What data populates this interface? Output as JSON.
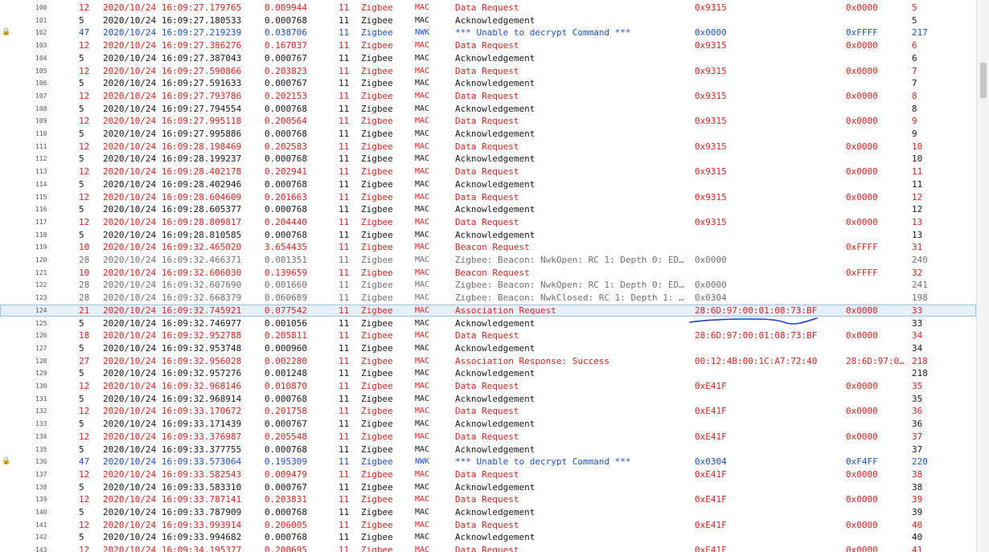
{
  "rows": [
    {
      "idx": "100",
      "lock": "",
      "len": "12",
      "time": "2020/10/24 16:09:27.179765",
      "delta": "0.009944",
      "ch": "11",
      "proto": "Zigbee",
      "layer": "MAC",
      "info": "Data Request",
      "src": "0x9315",
      "dst": "0x0000",
      "seq": "5",
      "color": "red"
    },
    {
      "idx": "101",
      "lock": "",
      "len": "5",
      "time": "2020/10/24 16:09:27.180533",
      "delta": "0.000768",
      "ch": "11",
      "proto": "Zigbee",
      "layer": "MAC",
      "info": "Acknowledgement",
      "src": "",
      "dst": "",
      "seq": "5",
      "color": "black"
    },
    {
      "idx": "102",
      "lock": "🔒",
      "len": "47",
      "time": "2020/10/24 16:09:27.219239",
      "delta": "0.038706",
      "ch": "11",
      "proto": "Zigbee",
      "layer": "NWK",
      "info": "*** Unable to decrypt Command ***",
      "src": "0x0000",
      "dst": "0xFFFF",
      "seq": "217",
      "color": "blue"
    },
    {
      "idx": "103",
      "lock": "",
      "len": "12",
      "time": "2020/10/24 16:09:27.386276",
      "delta": "0.167037",
      "ch": "11",
      "proto": "Zigbee",
      "layer": "MAC",
      "info": "Data Request",
      "src": "0x9315",
      "dst": "0x0000",
      "seq": "6",
      "color": "red"
    },
    {
      "idx": "104",
      "lock": "",
      "len": "5",
      "time": "2020/10/24 16:09:27.387043",
      "delta": "0.000767",
      "ch": "11",
      "proto": "Zigbee",
      "layer": "MAC",
      "info": "Acknowledgement",
      "src": "",
      "dst": "",
      "seq": "6",
      "color": "black"
    },
    {
      "idx": "105",
      "lock": "",
      "len": "12",
      "time": "2020/10/24 16:09:27.590866",
      "delta": "0.203823",
      "ch": "11",
      "proto": "Zigbee",
      "layer": "MAC",
      "info": "Data Request",
      "src": "0x9315",
      "dst": "0x0000",
      "seq": "7",
      "color": "red"
    },
    {
      "idx": "106",
      "lock": "",
      "len": "5",
      "time": "2020/10/24 16:09:27.591633",
      "delta": "0.000767",
      "ch": "11",
      "proto": "Zigbee",
      "layer": "MAC",
      "info": "Acknowledgement",
      "src": "",
      "dst": "",
      "seq": "7",
      "color": "black"
    },
    {
      "idx": "107",
      "lock": "",
      "len": "12",
      "time": "2020/10/24 16:09:27.793786",
      "delta": "0.202153",
      "ch": "11",
      "proto": "Zigbee",
      "layer": "MAC",
      "info": "Data Request",
      "src": "0x9315",
      "dst": "0x0000",
      "seq": "8",
      "color": "red"
    },
    {
      "idx": "108",
      "lock": "",
      "len": "5",
      "time": "2020/10/24 16:09:27.794554",
      "delta": "0.000768",
      "ch": "11",
      "proto": "Zigbee",
      "layer": "MAC",
      "info": "Acknowledgement",
      "src": "",
      "dst": "",
      "seq": "8",
      "color": "black"
    },
    {
      "idx": "109",
      "lock": "",
      "len": "12",
      "time": "2020/10/24 16:09:27.995118",
      "delta": "0.200564",
      "ch": "11",
      "proto": "Zigbee",
      "layer": "MAC",
      "info": "Data Request",
      "src": "0x9315",
      "dst": "0x0000",
      "seq": "9",
      "color": "red"
    },
    {
      "idx": "110",
      "lock": "",
      "len": "5",
      "time": "2020/10/24 16:09:27.995886",
      "delta": "0.000768",
      "ch": "11",
      "proto": "Zigbee",
      "layer": "MAC",
      "info": "Acknowledgement",
      "src": "",
      "dst": "",
      "seq": "9",
      "color": "black"
    },
    {
      "idx": "111",
      "lock": "",
      "len": "12",
      "time": "2020/10/24 16:09:28.198469",
      "delta": "0.202583",
      "ch": "11",
      "proto": "Zigbee",
      "layer": "MAC",
      "info": "Data Request",
      "src": "0x9315",
      "dst": "0x0000",
      "seq": "10",
      "color": "red"
    },
    {
      "idx": "112",
      "lock": "",
      "len": "5",
      "time": "2020/10/24 16:09:28.199237",
      "delta": "0.000768",
      "ch": "11",
      "proto": "Zigbee",
      "layer": "MAC",
      "info": "Acknowledgement",
      "src": "",
      "dst": "",
      "seq": "10",
      "color": "black"
    },
    {
      "idx": "113",
      "lock": "",
      "len": "12",
      "time": "2020/10/24 16:09:28.402178",
      "delta": "0.202941",
      "ch": "11",
      "proto": "Zigbee",
      "layer": "MAC",
      "info": "Data Request",
      "src": "0x9315",
      "dst": "0x0000",
      "seq": "11",
      "color": "red"
    },
    {
      "idx": "114",
      "lock": "",
      "len": "5",
      "time": "2020/10/24 16:09:28.402946",
      "delta": "0.000768",
      "ch": "11",
      "proto": "Zigbee",
      "layer": "MAC",
      "info": "Acknowledgement",
      "src": "",
      "dst": "",
      "seq": "11",
      "color": "black"
    },
    {
      "idx": "115",
      "lock": "",
      "len": "12",
      "time": "2020/10/24 16:09:28.604609",
      "delta": "0.201663",
      "ch": "11",
      "proto": "Zigbee",
      "layer": "MAC",
      "info": "Data Request",
      "src": "0x9315",
      "dst": "0x0000",
      "seq": "12",
      "color": "red"
    },
    {
      "idx": "116",
      "lock": "",
      "len": "5",
      "time": "2020/10/24 16:09:28.605377",
      "delta": "0.000768",
      "ch": "11",
      "proto": "Zigbee",
      "layer": "MAC",
      "info": "Acknowledgement",
      "src": "",
      "dst": "",
      "seq": "12",
      "color": "black"
    },
    {
      "idx": "117",
      "lock": "",
      "len": "12",
      "time": "2020/10/24 16:09:28.809817",
      "delta": "0.204440",
      "ch": "11",
      "proto": "Zigbee",
      "layer": "MAC",
      "info": "Data Request",
      "src": "0x9315",
      "dst": "0x0000",
      "seq": "13",
      "color": "red"
    },
    {
      "idx": "118",
      "lock": "",
      "len": "5",
      "time": "2020/10/24 16:09:28.810585",
      "delta": "0.000768",
      "ch": "11",
      "proto": "Zigbee",
      "layer": "MAC",
      "info": "Acknowledgement",
      "src": "",
      "dst": "",
      "seq": "13",
      "color": "black"
    },
    {
      "idx": "119",
      "lock": "",
      "len": "10",
      "time": "2020/10/24 16:09:32.465020",
      "delta": "3.654435",
      "ch": "11",
      "proto": "Zigbee",
      "layer": "MAC",
      "info": "Beacon Request",
      "src": "",
      "dst": "0xFFFF",
      "seq": "31",
      "color": "red"
    },
    {
      "idx": "120",
      "lock": "",
      "len": "28",
      "time": "2020/10/24 16:09:32.466371",
      "delta": "0.001351",
      "ch": "11",
      "proto": "Zigbee",
      "layer": "MAC",
      "info": "Zigbee: Beacon: NwkOpen: RC 1: Depth 0: EDC…",
      "src": "0x0000",
      "dst": "",
      "seq": "240",
      "color": "gray"
    },
    {
      "idx": "121",
      "lock": "",
      "len": "10",
      "time": "2020/10/24 16:09:32.606030",
      "delta": "0.139659",
      "ch": "11",
      "proto": "Zigbee",
      "layer": "MAC",
      "info": "Beacon Request",
      "src": "",
      "dst": "0xFFFF",
      "seq": "32",
      "color": "red"
    },
    {
      "idx": "122",
      "lock": "",
      "len": "28",
      "time": "2020/10/24 16:09:32.607690",
      "delta": "0.001660",
      "ch": "11",
      "proto": "Zigbee",
      "layer": "MAC",
      "info": "Zigbee: Beacon: NwkOpen: RC 1: Depth 0: EDC…",
      "src": "0x0000",
      "dst": "",
      "seq": "241",
      "color": "gray"
    },
    {
      "idx": "123",
      "lock": "",
      "len": "28",
      "time": "2020/10/24 16:09:32.668379",
      "delta": "0.060689",
      "ch": "11",
      "proto": "Zigbee",
      "layer": "MAC",
      "info": "Zigbee: Beacon: NwkClosed: RC 1: Depth 1: E…",
      "src": "0x0304",
      "dst": "",
      "seq": "198",
      "color": "gray"
    },
    {
      "idx": "124",
      "lock": "",
      "len": "21",
      "time": "2020/10/24 16:09:32.745921",
      "delta": "0.077542",
      "ch": "11",
      "proto": "Zigbee",
      "layer": "MAC",
      "info": "Association Request",
      "src": "28:6D:97:00:01:08:73:BF",
      "dst": "0x0000",
      "seq": "33",
      "color": "red",
      "selected": true
    },
    {
      "idx": "125",
      "lock": "",
      "len": "5",
      "time": "2020/10/24 16:09:32.746977",
      "delta": "0.001056",
      "ch": "11",
      "proto": "Zigbee",
      "layer": "MAC",
      "info": "Acknowledgement",
      "src": "",
      "dst": "",
      "seq": "33",
      "color": "black"
    },
    {
      "idx": "126",
      "lock": "",
      "len": "18",
      "time": "2020/10/24 16:09:32.952788",
      "delta": "0.205811",
      "ch": "11",
      "proto": "Zigbee",
      "layer": "MAC",
      "info": "Data Request",
      "src": "28:6D:97:00:01:08:73:BF",
      "dst": "0x0000",
      "seq": "34",
      "color": "red"
    },
    {
      "idx": "127",
      "lock": "",
      "len": "5",
      "time": "2020/10/24 16:09:32.953748",
      "delta": "0.000960",
      "ch": "11",
      "proto": "Zigbee",
      "layer": "MAC",
      "info": "Acknowledgement",
      "src": "",
      "dst": "",
      "seq": "34",
      "color": "black"
    },
    {
      "idx": "128",
      "lock": "",
      "len": "27",
      "time": "2020/10/24 16:09:32.956028",
      "delta": "0.002280",
      "ch": "11",
      "proto": "Zigbee",
      "layer": "MAC",
      "info": "Association Response: Success",
      "src": "00:12:4B:00:1C:A7:72:40",
      "dst": "28:6D:97:0…",
      "seq": "218",
      "color": "red"
    },
    {
      "idx": "129",
      "lock": "",
      "len": "5",
      "time": "2020/10/24 16:09:32.957276",
      "delta": "0.001248",
      "ch": "11",
      "proto": "Zigbee",
      "layer": "MAC",
      "info": "Acknowledgement",
      "src": "",
      "dst": "",
      "seq": "218",
      "color": "black"
    },
    {
      "idx": "130",
      "lock": "",
      "len": "12",
      "time": "2020/10/24 16:09:32.968146",
      "delta": "0.010870",
      "ch": "11",
      "proto": "Zigbee",
      "layer": "MAC",
      "info": "Data Request",
      "src": "0xE41F",
      "dst": "0x0000",
      "seq": "35",
      "color": "red"
    },
    {
      "idx": "131",
      "lock": "",
      "len": "5",
      "time": "2020/10/24 16:09:32.968914",
      "delta": "0.000768",
      "ch": "11",
      "proto": "Zigbee",
      "layer": "MAC",
      "info": "Acknowledgement",
      "src": "",
      "dst": "",
      "seq": "35",
      "color": "black"
    },
    {
      "idx": "132",
      "lock": "",
      "len": "12",
      "time": "2020/10/24 16:09:33.170672",
      "delta": "0.201758",
      "ch": "11",
      "proto": "Zigbee",
      "layer": "MAC",
      "info": "Data Request",
      "src": "0xE41F",
      "dst": "0x0000",
      "seq": "36",
      "color": "red"
    },
    {
      "idx": "133",
      "lock": "",
      "len": "5",
      "time": "2020/10/24 16:09:33.171439",
      "delta": "0.000767",
      "ch": "11",
      "proto": "Zigbee",
      "layer": "MAC",
      "info": "Acknowledgement",
      "src": "",
      "dst": "",
      "seq": "36",
      "color": "black"
    },
    {
      "idx": "134",
      "lock": "",
      "len": "12",
      "time": "2020/10/24 16:09:33.376987",
      "delta": "0.205548",
      "ch": "11",
      "proto": "Zigbee",
      "layer": "MAC",
      "info": "Data Request",
      "src": "0xE41F",
      "dst": "0x0000",
      "seq": "37",
      "color": "red"
    },
    {
      "idx": "135",
      "lock": "",
      "len": "5",
      "time": "2020/10/24 16:09:33.377755",
      "delta": "0.000768",
      "ch": "11",
      "proto": "Zigbee",
      "layer": "MAC",
      "info": "Acknowledgement",
      "src": "",
      "dst": "",
      "seq": "37",
      "color": "black"
    },
    {
      "idx": "136",
      "lock": "🔒",
      "len": "47",
      "time": "2020/10/24 16:09:33.573064",
      "delta": "0.195309",
      "ch": "11",
      "proto": "Zigbee",
      "layer": "NWK",
      "info": "*** Unable to decrypt Command ***",
      "src": "0x0304",
      "dst": "0xF4FF",
      "seq": "220",
      "color": "blue"
    },
    {
      "idx": "137",
      "lock": "",
      "len": "12",
      "time": "2020/10/24 16:09:33.582543",
      "delta": "0.009479",
      "ch": "11",
      "proto": "Zigbee",
      "layer": "MAC",
      "info": "Data Request",
      "src": "0xE41F",
      "dst": "0x0000",
      "seq": "38",
      "color": "red"
    },
    {
      "idx": "138",
      "lock": "",
      "len": "5",
      "time": "2020/10/24 16:09:33.583310",
      "delta": "0.000767",
      "ch": "11",
      "proto": "Zigbee",
      "layer": "MAC",
      "info": "Acknowledgement",
      "src": "",
      "dst": "",
      "seq": "38",
      "color": "black"
    },
    {
      "idx": "139",
      "lock": "",
      "len": "12",
      "time": "2020/10/24 16:09:33.787141",
      "delta": "0.203831",
      "ch": "11",
      "proto": "Zigbee",
      "layer": "MAC",
      "info": "Data Request",
      "src": "0xE41F",
      "dst": "0x0000",
      "seq": "39",
      "color": "red"
    },
    {
      "idx": "140",
      "lock": "",
      "len": "5",
      "time": "2020/10/24 16:09:33.787909",
      "delta": "0.000768",
      "ch": "11",
      "proto": "Zigbee",
      "layer": "MAC",
      "info": "Acknowledgement",
      "src": "",
      "dst": "",
      "seq": "39",
      "color": "black"
    },
    {
      "idx": "141",
      "lock": "",
      "len": "12",
      "time": "2020/10/24 16:09:33.993914",
      "delta": "0.206005",
      "ch": "11",
      "proto": "Zigbee",
      "layer": "MAC",
      "info": "Data Request",
      "src": "0xE41F",
      "dst": "0x0000",
      "seq": "40",
      "color": "red"
    },
    {
      "idx": "142",
      "lock": "",
      "len": "5",
      "time": "2020/10/24 16:09:33.994682",
      "delta": "0.000768",
      "ch": "11",
      "proto": "Zigbee",
      "layer": "MAC",
      "info": "Acknowledgement",
      "src": "",
      "dst": "",
      "seq": "40",
      "color": "black"
    },
    {
      "idx": "143",
      "lock": "",
      "len": "12",
      "time": "2020/10/24 16:09:34.195377",
      "delta": "0.200695",
      "ch": "11",
      "proto": "Zigbee",
      "layer": "MAC",
      "info": "Data Request",
      "src": "0xE41F",
      "dst": "0x0000",
      "seq": "41",
      "color": "red"
    }
  ],
  "colors": {
    "red": "#e02020",
    "black": "#1a1a1a",
    "blue": "#1f4fd0",
    "gray": "#707070",
    "selection": "#e6f0fb",
    "annotation": "#1f3fcf"
  },
  "icons": {
    "lock": "lock-icon"
  }
}
